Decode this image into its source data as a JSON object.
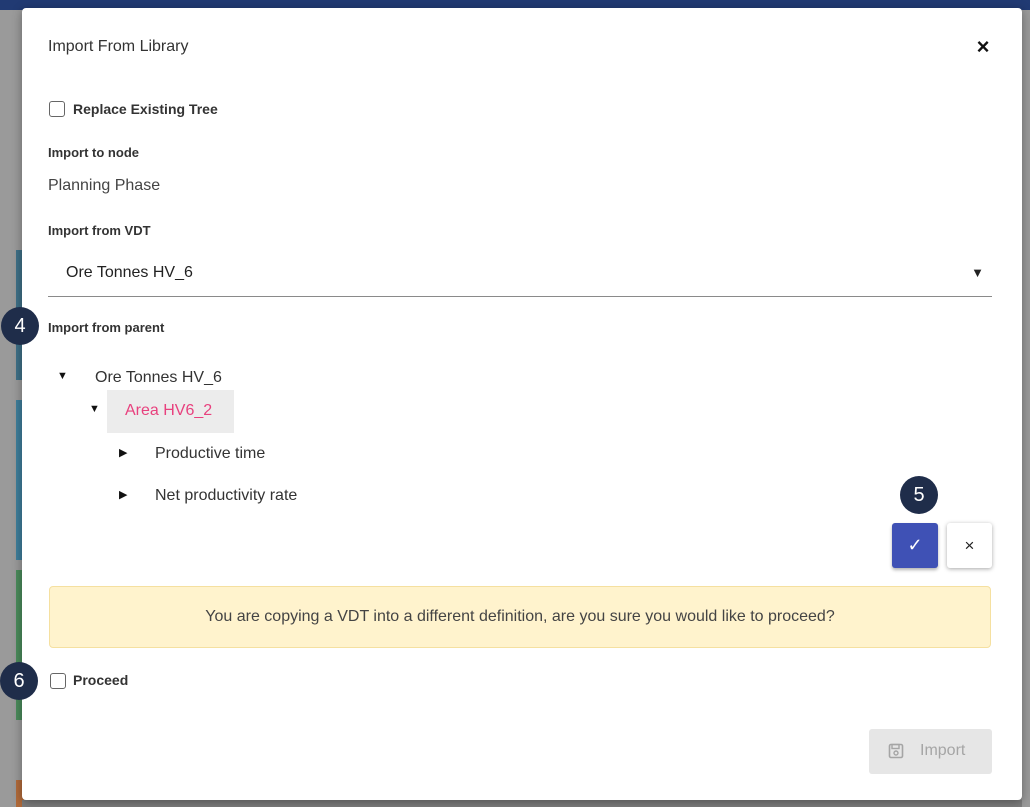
{
  "dialog": {
    "title": "Import From Library",
    "close_icon": "close-icon"
  },
  "replace_tree": {
    "label": "Replace Existing Tree",
    "checked": false
  },
  "import_to_node": {
    "label": "Import to node",
    "value": "Planning Phase"
  },
  "import_from_vdt": {
    "label": "Import from VDT",
    "selected": "Ore Tonnes HV_6",
    "caret": "▼"
  },
  "import_from_parent": {
    "label": "Import from parent",
    "tree": [
      {
        "label": "Ore Tonnes HV_6",
        "toggle": "▼",
        "level": 0
      },
      {
        "label": "Area HV6_2",
        "toggle": "▼",
        "level": 1,
        "selected": true
      },
      {
        "label": "Productive time",
        "toggle": "▶",
        "level": 2
      },
      {
        "label": "Net productivity rate",
        "toggle": "▶",
        "level": 2
      }
    ]
  },
  "actions": {
    "confirm_icon": "✓",
    "cancel_icon": "×"
  },
  "warning": {
    "text": "You are copying a VDT into a different definition, are you sure you would like to proceed?"
  },
  "proceed": {
    "label": "Proceed",
    "checked": false
  },
  "import_button": {
    "label": "Import",
    "icon": "save-icon",
    "disabled": true
  },
  "callouts": [
    "4",
    "5",
    "6"
  ],
  "colors": {
    "primary": "#3f51b5",
    "selected_text": "#e8417e",
    "warning_bg": "#fff3cd",
    "callout_bg": "#1f2d4a"
  }
}
